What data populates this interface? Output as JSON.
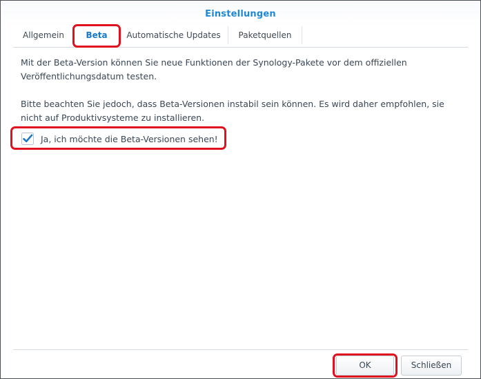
{
  "window": {
    "title": "Einstellungen"
  },
  "tabs": [
    {
      "label": "Allgemein",
      "active": false
    },
    {
      "label": "Beta",
      "active": true
    },
    {
      "label": "Automatische Updates",
      "active": false
    },
    {
      "label": "Paketquellen",
      "active": false
    }
  ],
  "content": {
    "paragraph1": "Mit der Beta-Version können Sie neue Funktionen der Synology-Pakete vor dem offiziellen Veröffentlichungsdatum testen.",
    "paragraph2": "Bitte beachten Sie jedoch, dass Beta-Versionen instabil sein können. Es wird daher empfohlen, sie nicht auf Produktivsysteme zu installieren.",
    "checkbox": {
      "label": "Ja, ich möchte die Beta-Versionen sehen!",
      "checked": true
    }
  },
  "footer": {
    "ok_label": "OK",
    "close_label": "Schließen"
  },
  "colors": {
    "accent": "#1a78c8",
    "highlight": "#e0101e"
  }
}
